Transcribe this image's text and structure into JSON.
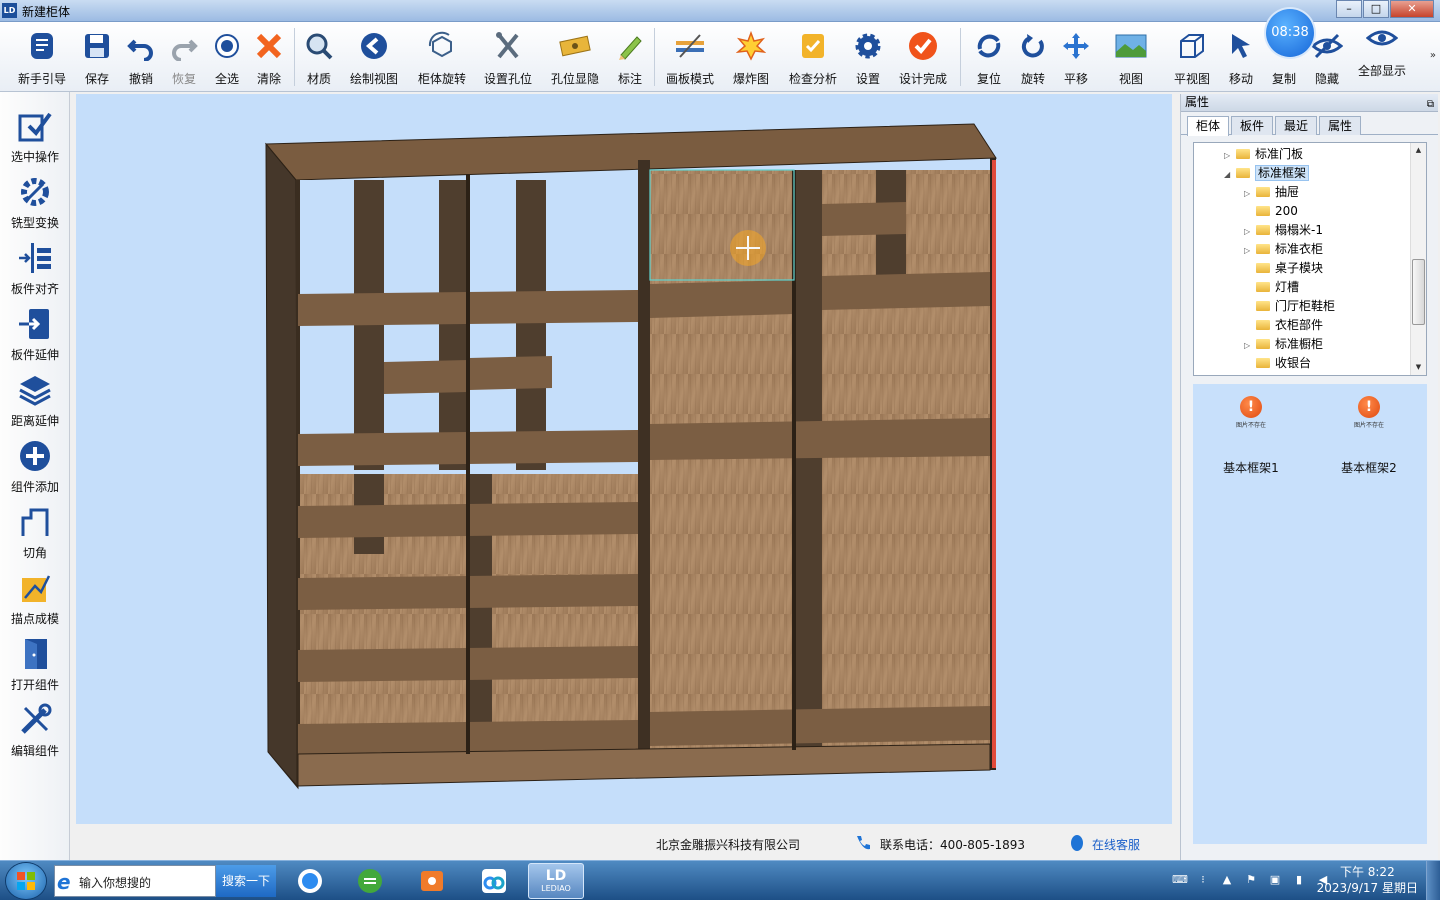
{
  "window": {
    "title": "新建柜体",
    "app_badge": "LD",
    "min": "–",
    "max": "□",
    "close": "✕"
  },
  "toolbar": {
    "items": [
      {
        "id": "guide",
        "label": "新手引导",
        "icon": "guide-icon"
      },
      {
        "id": "save",
        "label": "保存",
        "icon": "save-icon"
      },
      {
        "id": "undo",
        "label": "撤销",
        "icon": "undo-icon"
      },
      {
        "id": "redo",
        "label": "恢复",
        "icon": "redo-icon",
        "disabled": true
      },
      {
        "id": "select-all",
        "label": "全选",
        "icon": "select-all-icon"
      },
      {
        "id": "clear",
        "label": "清除",
        "icon": "clear-icon"
      },
      {
        "id": "material",
        "label": "材质",
        "icon": "material-icon"
      },
      {
        "id": "draw-view",
        "label": "绘制视图",
        "icon": "draw-view-icon"
      },
      {
        "id": "rotate-cabinet",
        "label": "柜体旋转",
        "icon": "rotate-cabinet-icon"
      },
      {
        "id": "set-holes",
        "label": "设置孔位",
        "icon": "set-holes-icon"
      },
      {
        "id": "holes-toggle",
        "label": "孔位显隐",
        "icon": "holes-toggle-icon"
      },
      {
        "id": "annotate",
        "label": "标注",
        "icon": "annotate-icon"
      },
      {
        "id": "panel-mode",
        "label": "画板模式",
        "icon": "panel-mode-icon"
      },
      {
        "id": "exploded",
        "label": "爆炸图",
        "icon": "exploded-icon"
      },
      {
        "id": "check",
        "label": "检查分析",
        "icon": "check-icon"
      },
      {
        "id": "settings",
        "label": "设置",
        "icon": "gear-icon"
      },
      {
        "id": "finish",
        "label": "设计完成",
        "icon": "finish-icon"
      },
      {
        "id": "reset",
        "label": "复位",
        "icon": "reset-icon"
      },
      {
        "id": "rotate",
        "label": "旋转",
        "icon": "rotate-icon"
      },
      {
        "id": "pan",
        "label": "平移",
        "icon": "pan-icon"
      },
      {
        "id": "view",
        "label": "视图",
        "icon": "view-icon"
      },
      {
        "id": "plan",
        "label": "平视图",
        "icon": "plan-view-icon"
      },
      {
        "id": "move",
        "label": "移动",
        "icon": "move-icon"
      },
      {
        "id": "copy",
        "label": "复制",
        "icon": "copy-icon"
      },
      {
        "id": "hide",
        "label": "隐藏",
        "icon": "hide-icon"
      },
      {
        "id": "show-all",
        "label": "全部显示",
        "icon": "show-all-icon"
      }
    ],
    "more": "»"
  },
  "clock_overlay": "08:38",
  "left_toolbar": {
    "items": [
      {
        "label": "选中操作",
        "icon": "select-op-icon"
      },
      {
        "label": "铣型变换",
        "icon": "milling-icon"
      },
      {
        "label": "板件对齐",
        "icon": "align-icon"
      },
      {
        "label": "板件延伸",
        "icon": "extend-icon"
      },
      {
        "label": "距离延伸",
        "icon": "distance-extend-icon"
      },
      {
        "label": "组件添加",
        "icon": "add-component-icon"
      },
      {
        "label": "切角",
        "icon": "chamfer-icon"
      },
      {
        "label": "描点成模",
        "icon": "trace-model-icon"
      },
      {
        "label": "打开组件",
        "icon": "open-component-icon"
      },
      {
        "label": "编辑组件",
        "icon": "edit-component-icon"
      }
    ]
  },
  "footer": {
    "company": "北京金雕振兴科技有限公司",
    "phone": "联系电话：400-805-1893",
    "service": "在线客服"
  },
  "right_panel": {
    "header": "属性",
    "pin": "⧉",
    "tabs": [
      "柜体",
      "板件",
      "最近",
      "属性"
    ],
    "active_tab": 0,
    "tree": [
      {
        "label": "标准门板",
        "level": 1,
        "arrow": "▷"
      },
      {
        "label": "标准框架",
        "level": 1,
        "arrow": "◢",
        "selected": true
      },
      {
        "label": "抽屉",
        "level": 2,
        "arrow": "▷"
      },
      {
        "label": "200",
        "level": 2,
        "arrow": ""
      },
      {
        "label": "榻榻米-1",
        "level": 2,
        "arrow": "▷"
      },
      {
        "label": "标准衣柜",
        "level": 2,
        "arrow": "▷"
      },
      {
        "label": "桌子模块",
        "level": 2,
        "arrow": ""
      },
      {
        "label": "灯槽",
        "level": 2,
        "arrow": ""
      },
      {
        "label": "门厅柜鞋柜",
        "level": 2,
        "arrow": ""
      },
      {
        "label": "衣柜部件",
        "level": 2,
        "arrow": ""
      },
      {
        "label": "标准橱柜",
        "level": 2,
        "arrow": "▷"
      },
      {
        "label": "收银台",
        "level": 2,
        "arrow": ""
      }
    ],
    "thumbnails": [
      {
        "name": "基本框架1",
        "missing": "图片不存在"
      },
      {
        "name": "基本框架2",
        "missing": "图片不存在"
      }
    ]
  },
  "taskbar": {
    "search_placeholder": "输入你想搜的",
    "search_button": "搜索一下",
    "active_app_label": "LEDIAO",
    "time": "下午 8:22",
    "date": "2023/9/17 星期日"
  },
  "colors": {
    "viewport_bg": "#c5defa",
    "wood_dark": "#4a3a2a",
    "wood_light": "#a07e5c",
    "accent_blue": "#1a5fc9"
  }
}
